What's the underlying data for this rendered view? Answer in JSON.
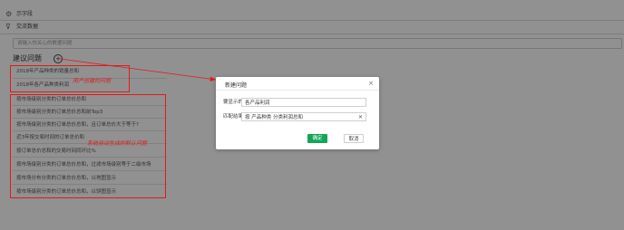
{
  "sidebar": {
    "rows": [
      {
        "icon": "settings-icon",
        "label": "示字段"
      },
      {
        "icon": "filter-icon",
        "label": "交流数据"
      }
    ]
  },
  "search": {
    "placeholder": "请输入你关心的数据问题"
  },
  "suggest": {
    "title": "建议问题",
    "user_created": [
      "2018年产品种类的销量总和",
      "2018年各产品种类利润"
    ],
    "auto_generated": [
      "按市场级别分类的订单总价总和",
      "按市场级别分类的订单总价总和前Top3",
      "按市场级别分类的订单总价总和，且订单总价大于等于?",
      "近3年按交易时间的订单总价和",
      "按订单总价总和的交易时间同环比%",
      "按市场级别分类的订单总价总和，过滤市场级别等于二级市场",
      "按市场分布分类的订单总价总和，以地图显示",
      "按市场级别分类的订单总价总和，以饼图显示"
    ]
  },
  "annotations": {
    "user_created_label": "用户创建的问题",
    "auto_label": "系统自动生成的默认问题"
  },
  "dialog": {
    "title": "新建问题",
    "text_label": "要显示的文本:",
    "text_value": "各产品利润",
    "match_label": "匹配结果:",
    "match_value": "按 产品种类 分类利润总和",
    "ok_label": "确定",
    "cancel_label": "取消"
  },
  "colors": {
    "annotation": "#e21a1a",
    "primary": "#13a656",
    "overlay": "rgba(0,0,0,0.43)"
  }
}
